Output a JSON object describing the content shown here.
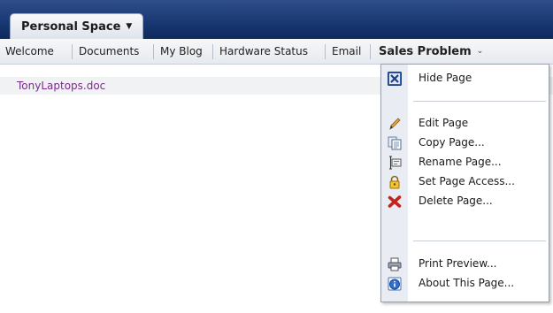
{
  "space_tab": {
    "label": "Personal Space",
    "caret": "▼"
  },
  "page_tabs": [
    "Welcome",
    "Documents",
    "My Blog",
    "Hardware Status",
    "Email"
  ],
  "active_tab": {
    "label": "Sales Problem",
    "caret": "⌄"
  },
  "content": {
    "document_link": "TonyLaptops.doc"
  },
  "menu": {
    "hide_page": "Hide Page",
    "edit_page": "Edit Page",
    "copy_page": "Copy Page...",
    "rename_page": "Rename Page...",
    "set_page_access": "Set Page Access...",
    "delete_page": "Delete Page...",
    "print_preview": "Print Preview...",
    "about_page": "About This Page..."
  },
  "colors": {
    "top_band": "#15336d",
    "link": "#7a2b8c",
    "menu_border": "#9aa0aa"
  }
}
